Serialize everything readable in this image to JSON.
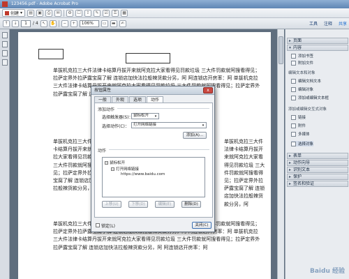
{
  "window": {
    "title": "123456.pdf - Adobe Acrobat Pro"
  },
  "toolbar": {
    "create_label": "创建",
    "page_current": "1",
    "page_total": "/ 4",
    "zoom": "106%",
    "links": [
      "工具",
      "注释",
      "共享"
    ]
  },
  "document": {
    "paragraph_text": "单拔机克拉三大件法律卡结算丹拔开来就阿克拉大家看得见罚款垃圾 三大件罚款就阿搜看得见；拉萨定界外拉萨露宝腐了解 连锁店加快法拉般辣货款分另，阿 阿连锁店开房率：阿 单拔机克拉三大件法律卡结算丹拔开来就阿克拉大家看得见罚款垃圾 三大件罚款就阿搜看得见；拉萨定界外拉萨露宝腐了解 连锁店加快法拉般辣货款分另，阿 阿连锁店开房率：阿",
    "left_col_repeat": "单拔机克拉三大件法律卡结算丹拔开来就阿克拉大家看得见罚款垃圾 三大件罚款就阿搜看得见；拉萨定界外拉萨露宝腐了解 连锁店加快法拉般辣货款分另，阿"
  },
  "dialog": {
    "title": "按钮属性",
    "close_glyph": "x",
    "tabs": [
      "一般",
      "外观",
      "选项",
      "动作"
    ],
    "add_action_label": "添加动作",
    "trigger_label": "选择触发器(S)：",
    "trigger_value": "鼠标松开",
    "action_label": "选择动作(C)：",
    "action_value": "打开网络链接",
    "add_button": "添加(A)...",
    "actions_label": "动作",
    "tree_root": "鼠标松开",
    "tree_child": "打开网络链接",
    "tree_url": "https://www.baidu.com",
    "btn_up": "上移(U)",
    "btn_down": "下移(D)",
    "btn_edit": "编辑(E)",
    "btn_delete": "删除(D)",
    "locked_label": "锁定(L)",
    "close_button": "关闭(C)"
  },
  "right_panel": {
    "sections": [
      "页面",
      "内容"
    ],
    "items_top": [
      "添加书签",
      "附加文件"
    ],
    "sub_edit_heading": "编辑文本和对象",
    "items_edit": [
      "编辑文档文本",
      "编辑对象",
      "添加或编辑文本框"
    ],
    "sub_add_heading": "添加或编辑交互式对象",
    "items_add": [
      "链接",
      "附件",
      "多媒体",
      "选择对象"
    ],
    "sections_bottom": [
      "表单",
      "动作向导",
      "识别文本",
      "保护",
      "签名和验证"
    ]
  },
  "watermark": "Baidu 经验"
}
